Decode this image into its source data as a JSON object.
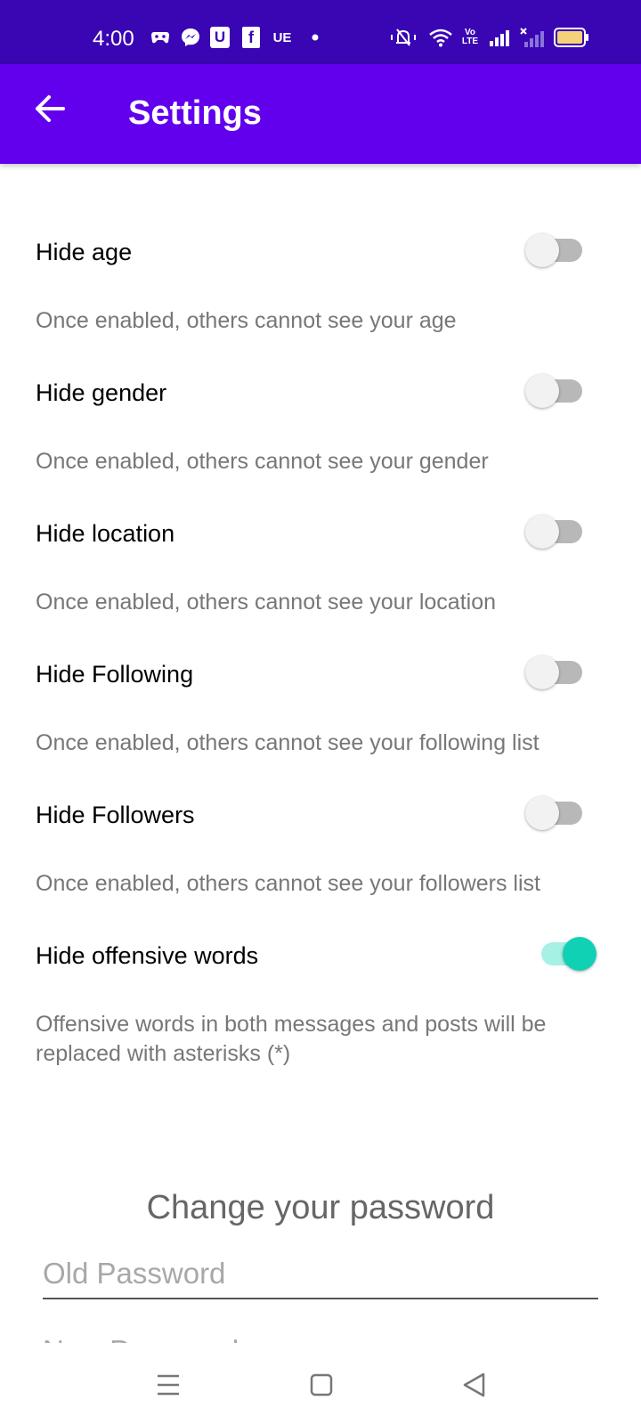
{
  "status_bar": {
    "time": "4:00",
    "indicator_icons": [
      "game-controller-icon",
      "messenger-icon",
      "u-app-icon",
      "facebook-icon",
      "ue-app-icon",
      "dot-icon"
    ],
    "ue_text": "UE",
    "u_text": "U",
    "fb_text": "f",
    "system_icons": [
      "muted-bell-icon",
      "wifi-icon",
      "volte-icon",
      "signal-icon",
      "signal-no-service-icon",
      "battery-icon"
    ],
    "volte_text": "Vo LTE",
    "battery_color": "#f4d27a"
  },
  "app_bar": {
    "title": "Settings",
    "back_icon": "arrow-left-icon",
    "color": "#6200ee"
  },
  "settings": [
    {
      "label": "Hide age",
      "description": "Once enabled, others cannot see your age",
      "enabled": false
    },
    {
      "label": "Hide gender",
      "description": "Once enabled, others cannot see your gender",
      "enabled": false
    },
    {
      "label": "Hide location",
      "description": "Once enabled, others cannot see your location",
      "enabled": false
    },
    {
      "label": "Hide Following",
      "description": "Once enabled, others cannot see your following list",
      "enabled": false
    },
    {
      "label": "Hide Followers",
      "description": "Once enabled, others cannot see your followers list",
      "enabled": false
    },
    {
      "label": "Hide offensive words",
      "description": "Offensive words in both messages and posts will be replaced with asterisks (*)",
      "enabled": true
    }
  ],
  "change_password": {
    "title": "Change your password",
    "old_password_placeholder": "Old Password",
    "new_password_placeholder": "New Password"
  },
  "nav_bar": {
    "buttons": [
      "menu-icon",
      "home-square-icon",
      "back-triangle-icon"
    ]
  },
  "colors": {
    "status_bar": "#3a06b4",
    "toggle_on": "#11d1b4",
    "toggle_off_track": "#b8b8b8"
  }
}
